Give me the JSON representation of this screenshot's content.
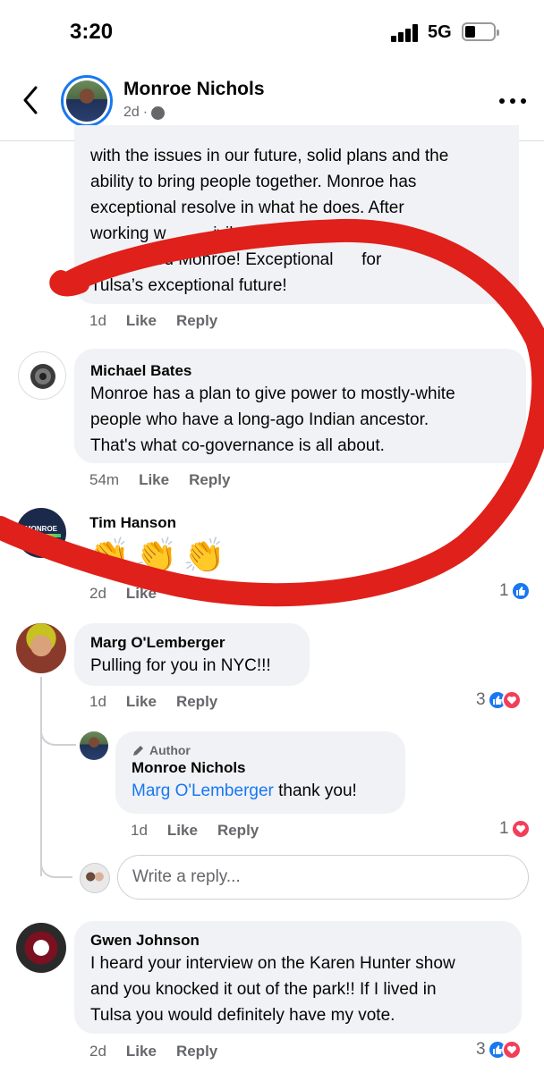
{
  "status": {
    "time": "3:20",
    "network": "5G"
  },
  "header": {
    "name": "Monroe Nichols",
    "age": "2d",
    "dot": "·",
    "globe_icon": "globe-icon"
  },
  "comments": [
    {
      "text_lines": [
        "with the issues in our future, solid plans and the",
        "ability to bring people together. Monroe has",
        "exceptional resolve in what he does. After",
        "working w          ivilege to watch",
        "    we need Monroe! Exceptional      for",
        "Tulsa’s exceptional future!"
      ],
      "time": "1d",
      "like": "Like",
      "reply": "Reply"
    },
    {
      "author": "Michael Bates",
      "text_lines": [
        "Monroe has a plan to give power to mostly-white",
        "people who have a long-ago Indian ancestor.",
        "That's what co-governance is all about."
      ],
      "time": "54m",
      "like": "Like",
      "reply": "Reply"
    },
    {
      "author": "Tim Hanson",
      "text": "👏👏👏",
      "time": "2d",
      "like": "Like",
      "reaction_count": "1",
      "avatar_text": {
        "top": "MONROE",
        "bottom": "MAYOR"
      }
    },
    {
      "author": "Marg O'Lemberger",
      "text": "Pulling for you in NYC!!!",
      "time": "1d",
      "like": "Like",
      "reply": "Reply",
      "reaction_count": "3"
    },
    {
      "badge": "Author",
      "author": "Monroe Nichols",
      "mention": "Marg O'Lemberger",
      "text": " thank you!",
      "time": "1d",
      "like": "Like",
      "reply": "Reply",
      "reaction_count": "1"
    },
    {
      "author": "Gwen Johnson",
      "text_lines": [
        "I heard your interview on the Karen Hunter show",
        "and you knocked it out of the park!! If I lived in",
        "Tulsa you would definitely have my vote."
      ],
      "time": "2d",
      "like": "Like",
      "reply": "Reply",
      "reaction_count": "3"
    }
  ],
  "reply_input": {
    "placeholder": "Write a reply..."
  },
  "colors": {
    "link": "#1877f2",
    "like": "#1877f2",
    "love": "#f33e58",
    "annotation": "#e0201a"
  }
}
